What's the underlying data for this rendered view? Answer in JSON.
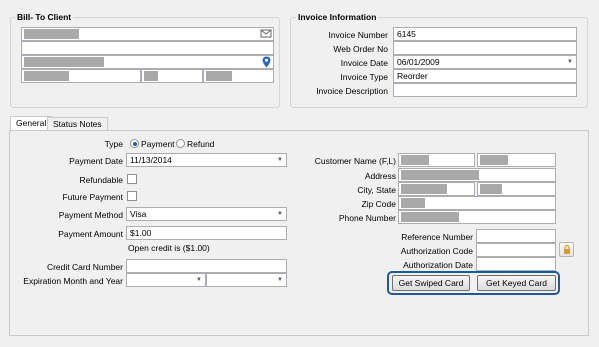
{
  "bill_to": {
    "title": "Bill- To Client"
  },
  "invoice": {
    "title": "Invoice Information",
    "fields": [
      {
        "label": "Invoice Number",
        "value": "6145"
      },
      {
        "label": "Web Order No",
        "value": ""
      },
      {
        "label": "Invoice Date",
        "value": "06/01/2009"
      },
      {
        "label": "Invoice Type",
        "value": "Reorder"
      },
      {
        "label": "Invoice Description",
        "value": ""
      }
    ]
  },
  "tabs": [
    {
      "label": "General",
      "active": true
    },
    {
      "label": "Status Notes",
      "active": false
    }
  ],
  "payment": {
    "type_label": "Type",
    "type_options": [
      "Payment",
      "Refund"
    ],
    "type_selected": "Payment",
    "date_label": "Payment Date",
    "date_value": "11/13/2014",
    "refundable_label": "Refundable",
    "future_label": "Future Payment",
    "method_label": "Payment Method",
    "method_value": "Visa",
    "amount_label": "Payment Amount",
    "amount_value": "$1.00",
    "open_credit_text": "Open credit is ($1.00)",
    "cc_label": "Credit Card Number",
    "cc_value": "",
    "exp_label": "Expiration Month and Year"
  },
  "customer": {
    "name_label": "Customer Name (F,L)",
    "address_label": "Address",
    "city_label": "City, State",
    "zip_label": "Zip Code",
    "phone_label": "Phone Number"
  },
  "auth": {
    "ref_label": "Reference Number",
    "code_label": "Authorization Code",
    "date_label": "Authorization Date",
    "swiped_button": "Get Swiped Card",
    "keyed_button": "Get Keyed Card"
  },
  "icons": {
    "mail": "mail-icon",
    "map_pin": "map-pin-icon",
    "lock": "lock-icon"
  },
  "colors": {
    "highlight_border": "#1c5d99",
    "pin": "#2b6cb5",
    "lock": "#d99a2b"
  }
}
